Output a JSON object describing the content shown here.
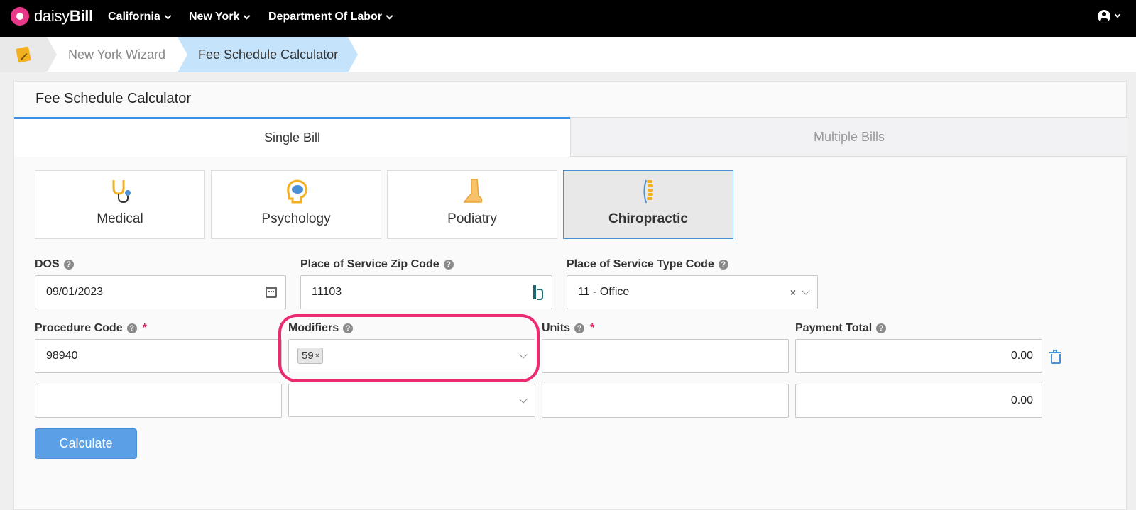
{
  "app": {
    "brand_light": "daisy",
    "brand_bold": "Bill"
  },
  "nav": {
    "items": [
      {
        "label": "California"
      },
      {
        "label": "New York"
      },
      {
        "label": "Department Of Labor"
      }
    ]
  },
  "breadcrumb": {
    "items": [
      {
        "label": "New York Wizard"
      },
      {
        "label": "Fee Schedule Calculator"
      }
    ]
  },
  "panel": {
    "title": "Fee Schedule Calculator",
    "tabs": [
      {
        "label": "Single Bill",
        "active": true
      },
      {
        "label": "Multiple Bills",
        "active": false
      }
    ]
  },
  "specialties": [
    {
      "label": "Medical",
      "icon": "stethoscope-icon"
    },
    {
      "label": "Psychology",
      "icon": "brain-icon"
    },
    {
      "label": "Podiatry",
      "icon": "foot-icon"
    },
    {
      "label": "Chiropractic",
      "icon": "spine-icon",
      "selected": true
    }
  ],
  "form": {
    "dos": {
      "label": "DOS",
      "value": "09/01/2023"
    },
    "zip": {
      "label": "Place of Service Zip Code",
      "value": "11103"
    },
    "pos_type": {
      "label": "Place of Service Type Code",
      "value": "11 - Office"
    },
    "procedure": {
      "label": "Procedure Code",
      "required_mark": "*"
    },
    "modifiers": {
      "label": "Modifiers"
    },
    "units": {
      "label": "Units",
      "required_mark": "*"
    },
    "payment": {
      "label": "Payment Total"
    },
    "rows": [
      {
        "procedure": "98940",
        "modifier_tag": "59",
        "modifier_remove": "×",
        "units": "",
        "payment": "0.00"
      },
      {
        "procedure": "",
        "units": "",
        "payment": "0.00"
      }
    ],
    "clear_symbol": "×",
    "help_symbol": "?"
  },
  "actions": {
    "calculate_label": "Calculate"
  },
  "colors": {
    "accent": "#5b9fe6",
    "highlight": "#ec2a72",
    "required": "#e0225b",
    "crumb_active": "#c5e3fb"
  }
}
